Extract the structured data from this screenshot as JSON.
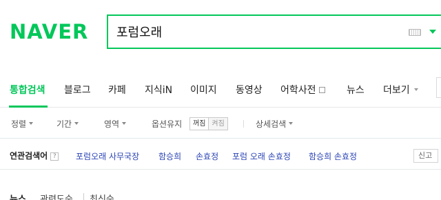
{
  "header": {
    "logo": "NAVER",
    "search_value": "포럼오래",
    "brand_color": "#03c75a",
    "keyboard_icon": "keyboard-icon",
    "dropdown_icon": "triangle-down-icon"
  },
  "tabs": {
    "items": [
      {
        "label": "통합검색",
        "active": true
      },
      {
        "label": "블로그"
      },
      {
        "label": "카페"
      },
      {
        "label": "지식iN"
      },
      {
        "label": "이미지"
      },
      {
        "label": "동영상"
      },
      {
        "label": "어학사전"
      },
      {
        "label": "뉴스"
      },
      {
        "label": "더보기"
      }
    ]
  },
  "options": {
    "sort": "정렬",
    "period": "기간",
    "area": "영역",
    "keep_option": "옵션유지",
    "toggle_off": "꺼짐",
    "toggle_on": "켜짐",
    "detail": "상세검색"
  },
  "related": {
    "title": "연관검색어",
    "help_icon": "?",
    "links": [
      "포럼오래 사무국장",
      "함승희",
      "손효정",
      "포럼 오래 손효정",
      "함승희 손효정"
    ],
    "report": "신고"
  },
  "bottom": {
    "section": "뉴스",
    "sort_relevance": "관련도순",
    "sort_latest": "최신순"
  }
}
